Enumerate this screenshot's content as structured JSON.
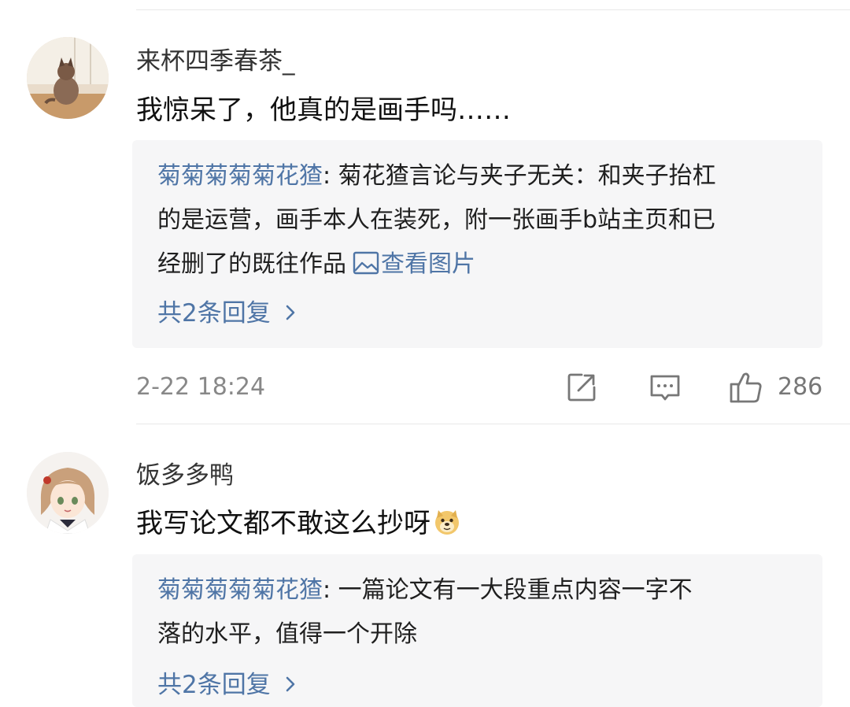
{
  "comments": [
    {
      "username": "来杯四季春茶_",
      "text": "我惊呆了，他真的是画手吗……",
      "reply": {
        "author": "菊菊菊菊菊花猹",
        "separator": ": ",
        "line1": "菊花猹言论与夹子无关：和夹子抬杠",
        "line2": "的是运营，画手本人在装死，附一张画手b站主页和已",
        "line3": "经删了的既往作品",
        "view_image": "查看图片",
        "count_label": "共2条回复"
      },
      "timestamp": "2-22 18:24",
      "likes": "286"
    },
    {
      "username": "饭多多鸭",
      "text": "我写论文都不敢这么抄呀",
      "emoji": "doge-emoji",
      "reply": {
        "author": "菊菊菊菊菊花猹",
        "separator": ": ",
        "line1": "一篇论文有一大段重点内容一字不",
        "line2": "落的水平，值得一个开除",
        "count_label": "共2条回复"
      }
    }
  ],
  "icons": {
    "forward": "share-icon",
    "comment": "comment-icon",
    "like": "thumbs-up-icon",
    "reply_chevron": "chevron-right-icon",
    "image": "image-icon"
  },
  "colors": {
    "link": "#4f75a6",
    "reply_bg": "#f6f6f7",
    "meta": "#888888"
  }
}
